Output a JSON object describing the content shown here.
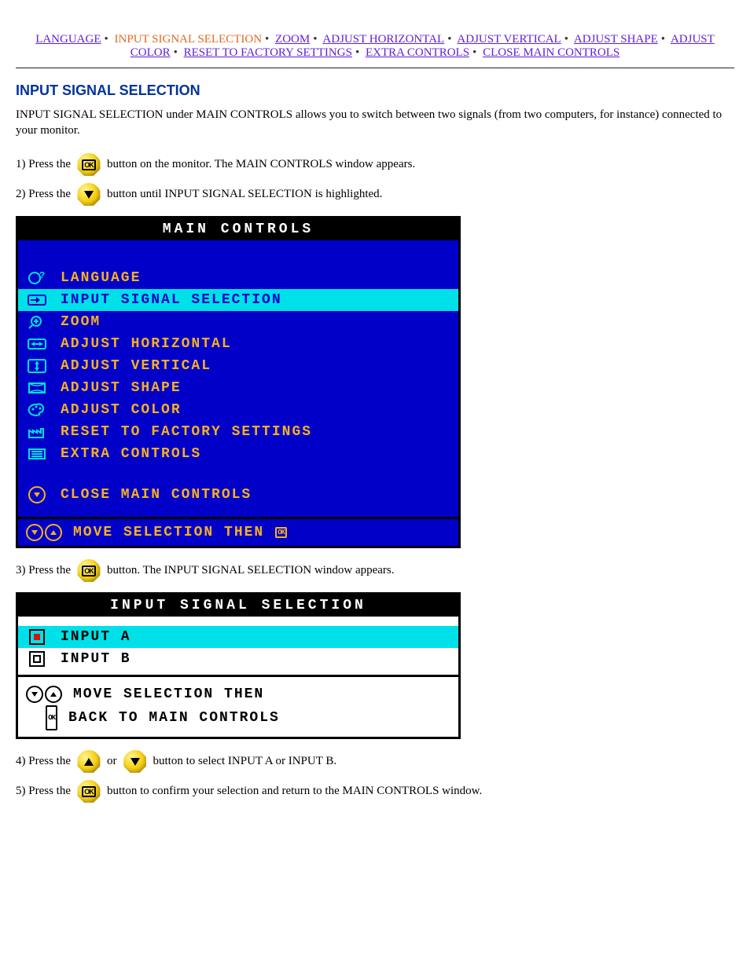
{
  "nav": {
    "links": [
      {
        "label": "LANGUAGE",
        "current": false
      },
      {
        "label": "INPUT SIGNAL SELECTION",
        "current": true
      },
      {
        "label": "ZOOM",
        "current": false
      },
      {
        "label": "ADJUST HORIZONTAL",
        "current": false
      },
      {
        "label": "ADJUST VERTICAL",
        "current": false
      },
      {
        "label": "ADJUST SHAPE",
        "current": false
      },
      {
        "label": "ADJUST COLOR",
        "current": false
      },
      {
        "label": "RESET TO FACTORY SETTINGS",
        "current": false
      },
      {
        "label": "EXTRA CONTROLS",
        "current": false
      },
      {
        "label": "CLOSE MAIN CONTROLS",
        "current": false
      }
    ]
  },
  "section_title": "INPUT SIGNAL SELECTION",
  "intro": "INPUT SIGNAL SELECTION under MAIN CONTROLS allows you to switch between two signals (from two computers, for instance) connected to your monitor.",
  "steps": {
    "s1a": "1) Press the ",
    "s1b": " button on the monitor. The MAIN CONTROLS window appears.",
    "s2a": "2) Press the ",
    "s2b": " button until INPUT SIGNAL SELECTION is highlighted.",
    "s3a": "3) Press the ",
    "s3b": " button. The INPUT SIGNAL SELECTION window appears.",
    "s4a": "4) Press the ",
    "s4_or": " or ",
    "s4b": " button to select INPUT A or INPUT B.",
    "s5a": "5) Press the ",
    "s5b": " button to confirm your selection and return to the MAIN CONTROLS window."
  },
  "osd_main": {
    "title": "MAIN CONTROLS",
    "items": [
      {
        "label": "LANGUAGE",
        "selected": false,
        "icon": "globe-q"
      },
      {
        "label": "INPUT SIGNAL SELECTION",
        "selected": true,
        "icon": "arrow-in"
      },
      {
        "label": "ZOOM",
        "selected": false,
        "icon": "magnify"
      },
      {
        "label": "ADJUST HORIZONTAL",
        "selected": false,
        "icon": "h-arrows"
      },
      {
        "label": "ADJUST VERTICAL",
        "selected": false,
        "icon": "v-arrows"
      },
      {
        "label": "ADJUST SHAPE",
        "selected": false,
        "icon": "shape"
      },
      {
        "label": "ADJUST COLOR",
        "selected": false,
        "icon": "palette"
      },
      {
        "label": "RESET TO FACTORY SETTINGS",
        "selected": false,
        "icon": "factory"
      },
      {
        "label": "EXTRA CONTROLS",
        "selected": false,
        "icon": "list"
      }
    ],
    "close_label": "CLOSE MAIN CONTROLS",
    "hint": "MOVE SELECTION THEN"
  },
  "osd_input": {
    "title": "INPUT SIGNAL SELECTION",
    "items": [
      {
        "label": "INPUT A",
        "selected": true
      },
      {
        "label": "INPUT B",
        "selected": false
      }
    ],
    "hint1": "MOVE SELECTION THEN",
    "hint2": "BACK TO MAIN CONTROLS"
  },
  "colors": {
    "osd_blue": "#0000c8",
    "osd_amber": "#f8b020",
    "osd_cyan": "#00e0e8",
    "heading_blue": "#003399",
    "nav_link": "#6020d8",
    "nav_current": "#e06a20",
    "button_yellow": "#f9d417"
  }
}
